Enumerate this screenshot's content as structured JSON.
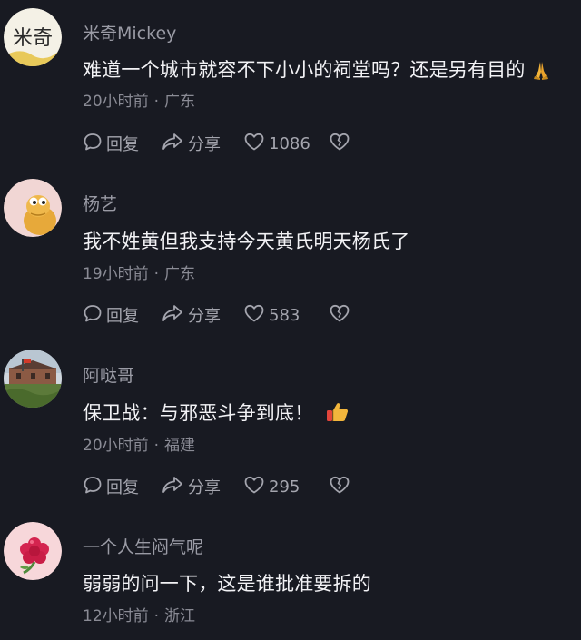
{
  "comments": [
    {
      "username": "米奇Mickey",
      "text": "难道一个城市就容不下小小的祠堂吗？还是另有目的",
      "emoji": "praying-hands",
      "time": "20小时前",
      "location": "广东",
      "actions": {
        "reply": "回复",
        "share": "分享",
        "likes": "1086"
      },
      "avatar_text": "米奇"
    },
    {
      "username": "杨艺",
      "text": "我不姓黄但我支持今天黄氏明天杨氏了",
      "time": "19小时前",
      "location": "广东",
      "actions": {
        "reply": "回复",
        "share": "分享",
        "likes": "583"
      }
    },
    {
      "username": "阿哒哥",
      "text": "保卫战：与邪恶斗争到底！",
      "emoji": "thumbs-up",
      "time": "20小时前",
      "location": "福建",
      "actions": {
        "reply": "回复",
        "share": "分享",
        "likes": "295"
      }
    },
    {
      "username": "一个人生闷气呢",
      "text": "弱弱的问一下，这是谁批准要拆的",
      "time": "12小时前",
      "location": "浙江"
    }
  ],
  "colors": {
    "background": "#181a22",
    "username": "#9a9ba5",
    "content": "#f2f2f5",
    "meta": "#8a8b95",
    "actions": "#a4a5ae"
  }
}
